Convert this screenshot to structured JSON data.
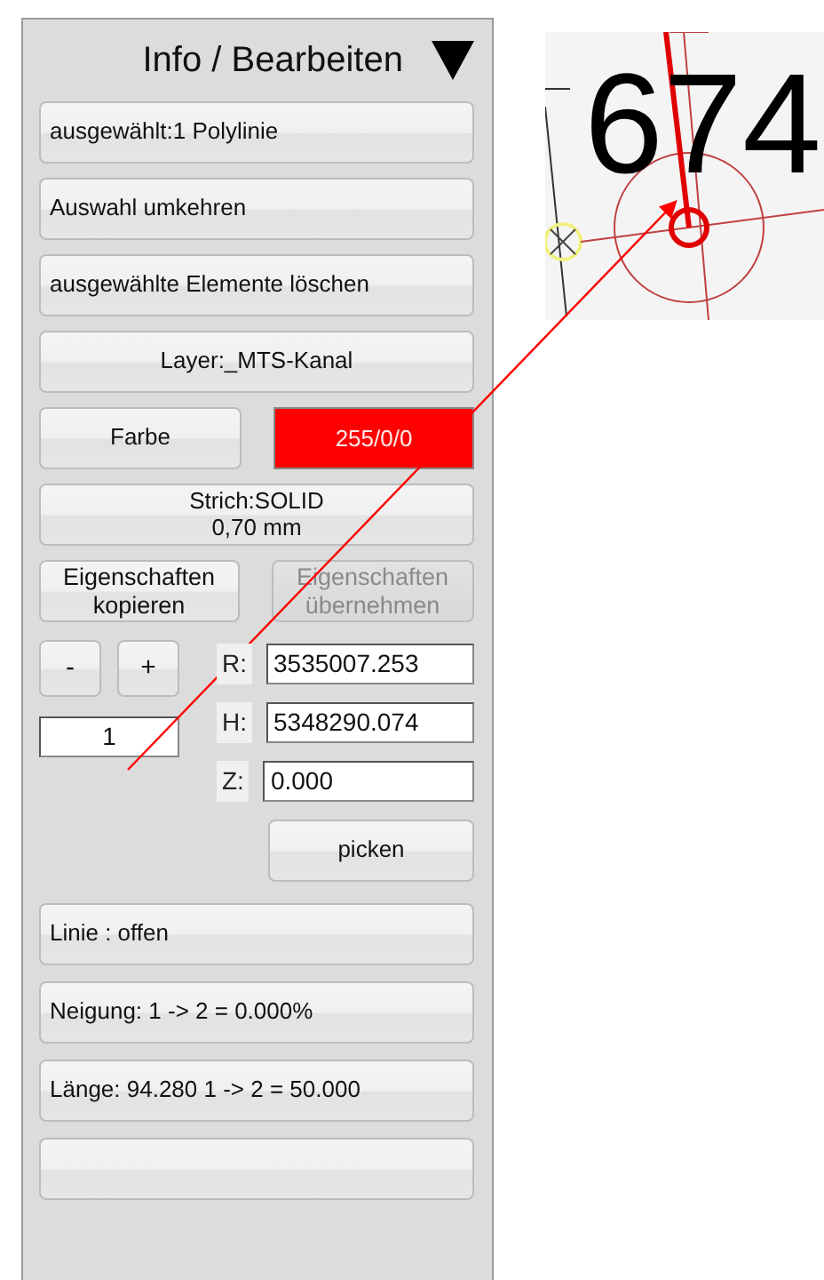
{
  "panel": {
    "title": "Info / Bearbeiten",
    "actions": [
      {
        "label": "ausgewählt:1 Polylinie",
        "kind": "command"
      },
      {
        "label": "Auswahl umkehren",
        "kind": "command"
      },
      {
        "label": "ausgewählte Elemente löschen",
        "kind": "command"
      },
      {
        "label": "Layer:_MTS-Kanal",
        "kind": "layer"
      }
    ],
    "color_button": "Farbe",
    "color_value": {
      "text": "255/0/0",
      "color": "#ff0000"
    },
    "stroke_lines": [
      "Strich:SOLID",
      "0,70 mm"
    ],
    "property_buttons": [
      {
        "lines": [
          "Eigenschaften",
          "kopieren"
        ],
        "disabled": false
      },
      {
        "lines": [
          "Eigenschaften",
          "übernehmen"
        ],
        "disabled": true
      }
    ],
    "step_buttons": [
      "-",
      "+"
    ],
    "step_value": "1",
    "coordinates": [
      {
        "label": "R:",
        "value": "3535007.253"
      },
      {
        "label": "H:",
        "value": "5348290.074"
      },
      {
        "label": "Z:",
        "value": "0.000"
      }
    ],
    "pick_button": "picken",
    "info": [
      {
        "kind": "text",
        "text": "Linie : offen"
      },
      {
        "kind": "text",
        "text": "Neigung: 1 -> 2 = 0.000%"
      },
      {
        "kind": "text",
        "text": "Länge: 94.280  1 -> 2 = 50.000"
      },
      {
        "kind": "blank"
      }
    ]
  },
  "inset": {
    "label": "674"
  }
}
